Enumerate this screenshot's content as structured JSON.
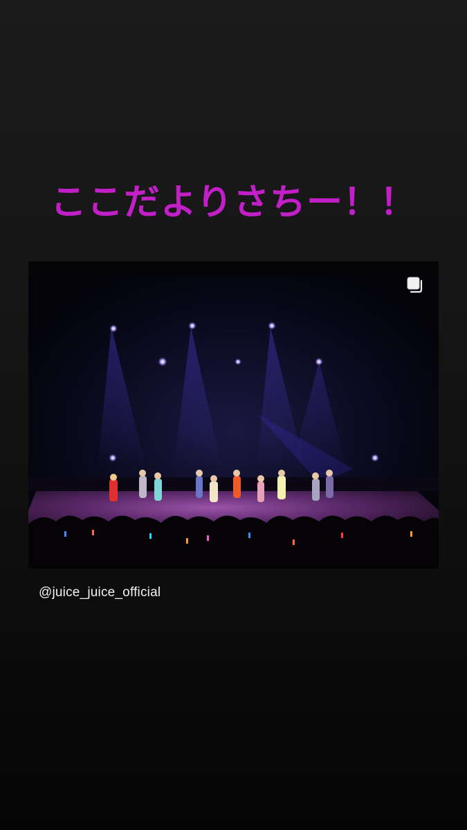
{
  "story": {
    "headline": "ここだよりさちー！！",
    "headline_color": "#c21fc9",
    "mention": "@juice_juice_official"
  },
  "post": {
    "media_description_icon": "multiple-photos-icon",
    "accent_colors": {
      "stage_light": "#8a4dff",
      "floor_glow": "#b054c8"
    }
  }
}
